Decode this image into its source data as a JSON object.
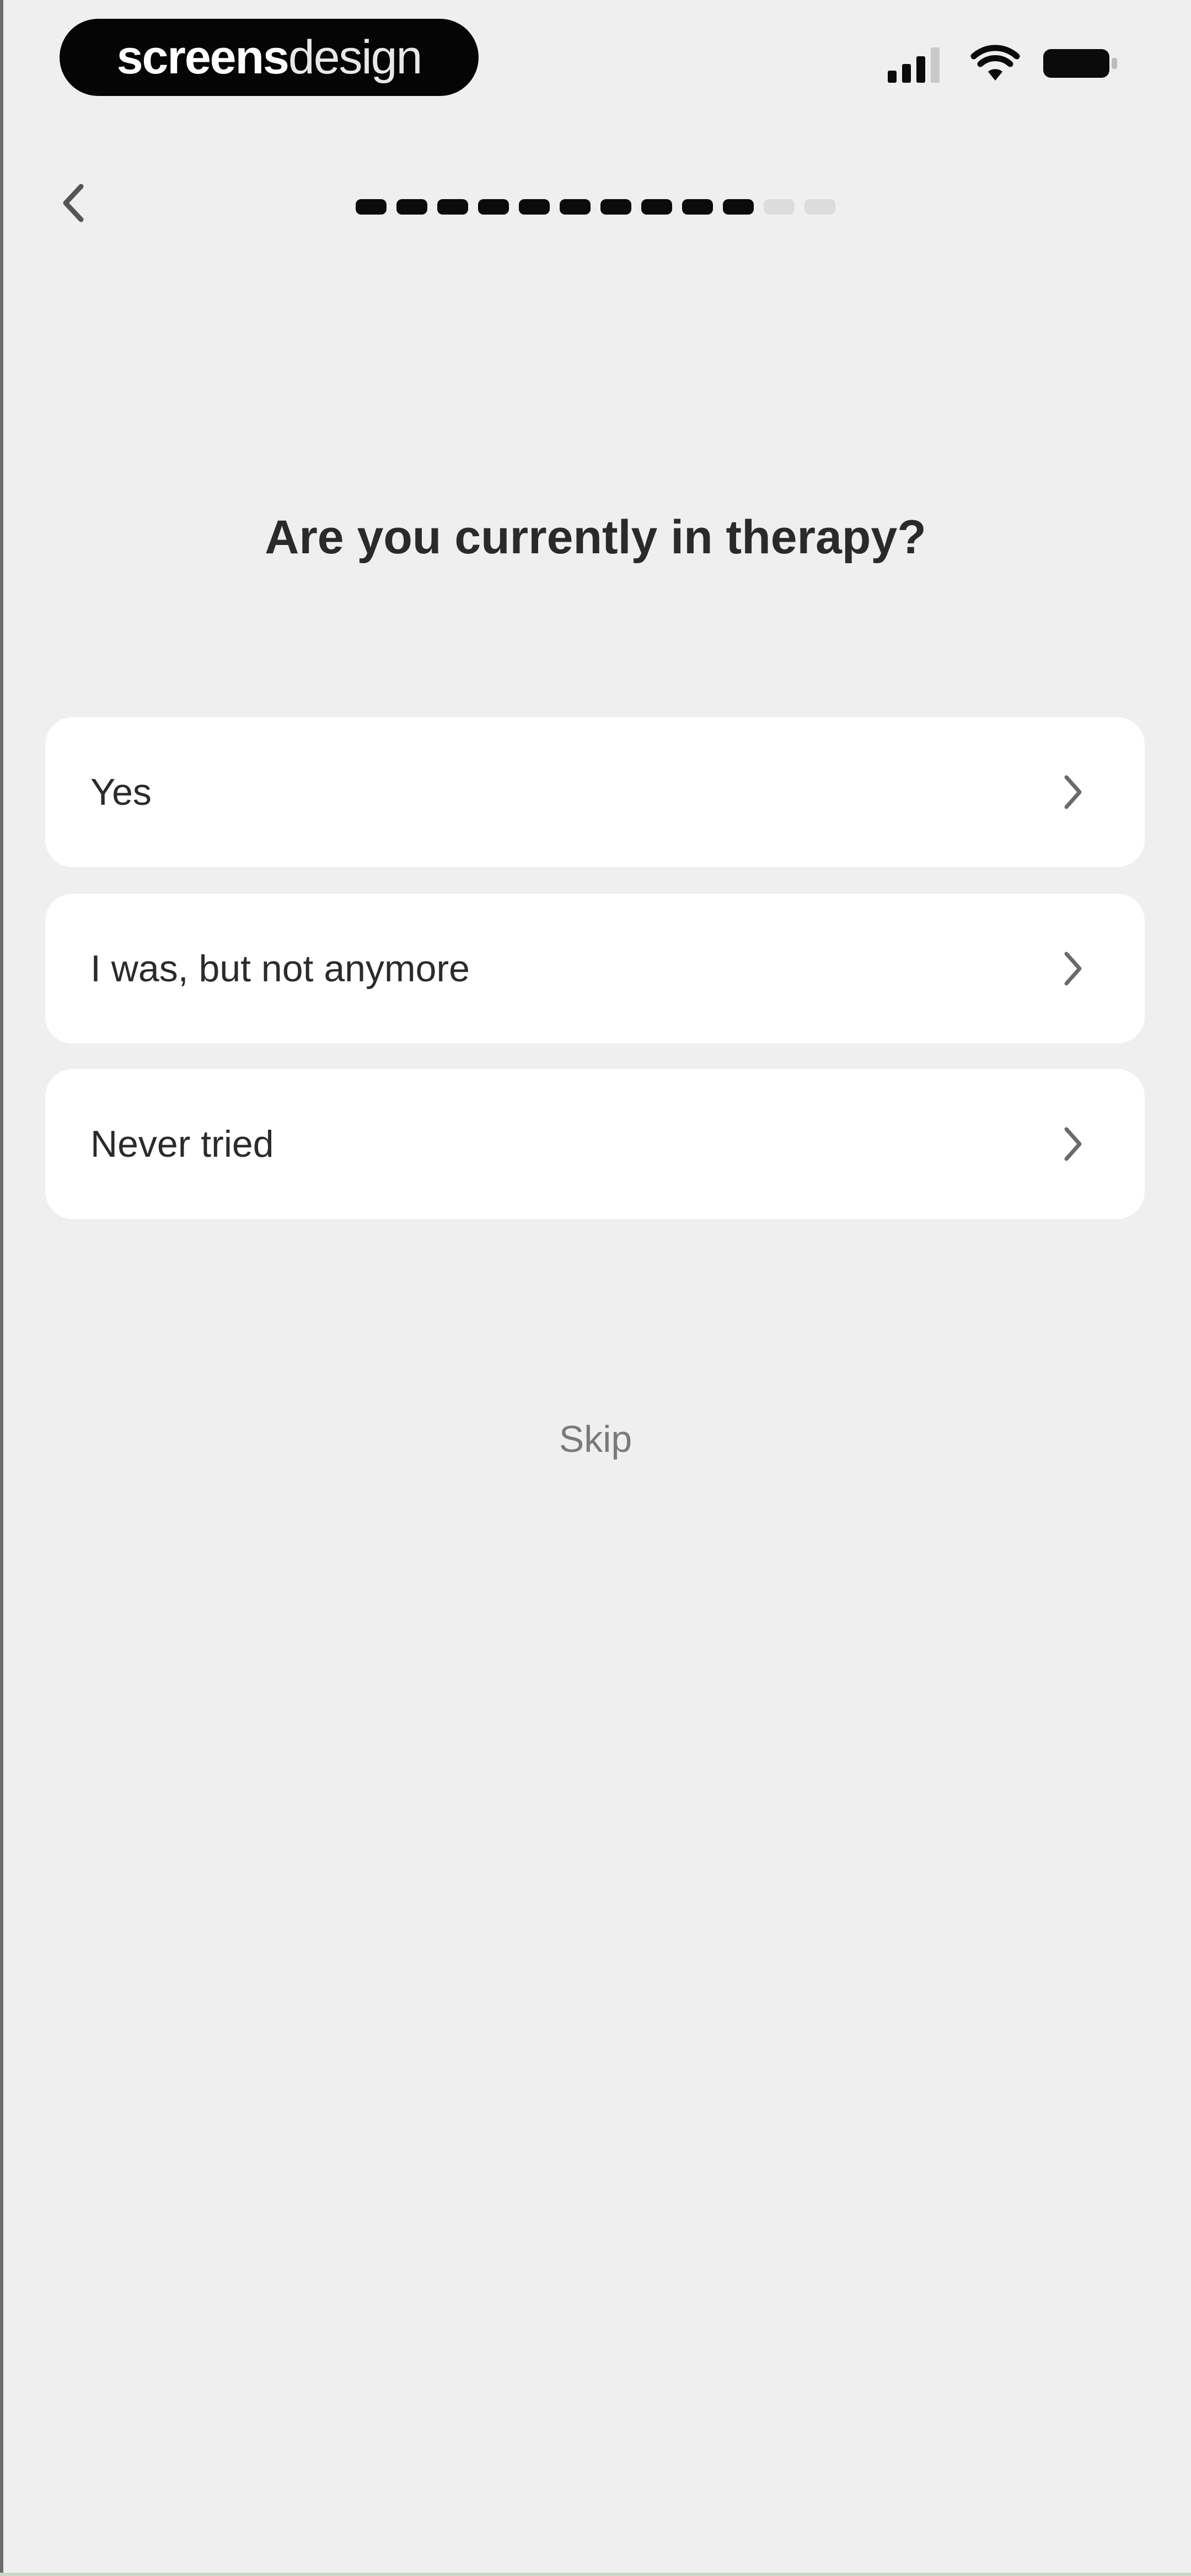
{
  "status_bar": {
    "brand_part1": "screens",
    "brand_part2": "design",
    "icons": [
      "signal-icon",
      "wifi-icon",
      "battery-icon"
    ]
  },
  "nav": {
    "back_icon": "chevron-left-icon",
    "progress": {
      "total_steps": 12,
      "completed_steps": 10
    }
  },
  "question": "Are you currently in therapy?",
  "options": [
    {
      "label": "Yes"
    },
    {
      "label": "I was, but not anymore"
    },
    {
      "label": "Never tried"
    }
  ],
  "skip_label": "Skip",
  "colors": {
    "background": "#efefef",
    "card": "#ffffff",
    "text": "#2a2a2a",
    "muted": "#7a7a7a",
    "accent": "#0b0b0b"
  }
}
